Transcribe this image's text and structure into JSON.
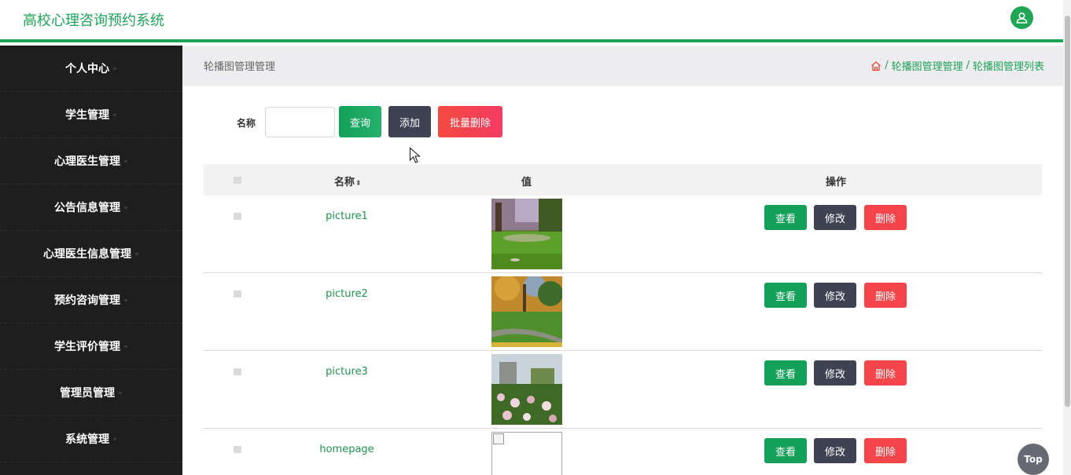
{
  "header": {
    "app_title": "高校心理咨询预约系统"
  },
  "sidebar": {
    "items": [
      {
        "label": "个人中心",
        "has_caret": true
      },
      {
        "label": "学生管理",
        "has_caret": true
      },
      {
        "label": "心理医生管理",
        "has_caret": true
      },
      {
        "label": "公告信息管理",
        "has_caret": true
      },
      {
        "label": "心理医生信息管理",
        "has_caret": true
      },
      {
        "label": "预约咨询管理",
        "has_caret": true
      },
      {
        "label": "学生评价管理",
        "has_caret": true
      },
      {
        "label": "管理员管理",
        "has_caret": true
      },
      {
        "label": "系统管理",
        "has_caret": true
      }
    ]
  },
  "breadcrumb": {
    "page_title": "轮播图管理管理",
    "crumb_1": "轮播图管理管理",
    "crumb_2": "轮播图管理列表",
    "separator": "/"
  },
  "search": {
    "label": "名称",
    "value": "",
    "query_button": "查询",
    "add_button": "添加",
    "batch_delete_button": "批量删除"
  },
  "table": {
    "columns": [
      "名称",
      "值",
      "操作"
    ],
    "sort_icon": "⬍",
    "rows": [
      {
        "name": "picture1",
        "image": "park-lawn"
      },
      {
        "name": "picture2",
        "image": "autumn-path"
      },
      {
        "name": "picture3",
        "image": "flower-garden"
      },
      {
        "name": "homepage",
        "image": "broken-image"
      }
    ],
    "actions": {
      "view": "查看",
      "edit": "修改",
      "delete": "删除"
    }
  },
  "top_button": "Top",
  "colors": {
    "brand_green": "#1fa555",
    "sidebar_bg": "#1e1e1f",
    "dark_button": "#3e4253",
    "danger": "#f3454a"
  }
}
